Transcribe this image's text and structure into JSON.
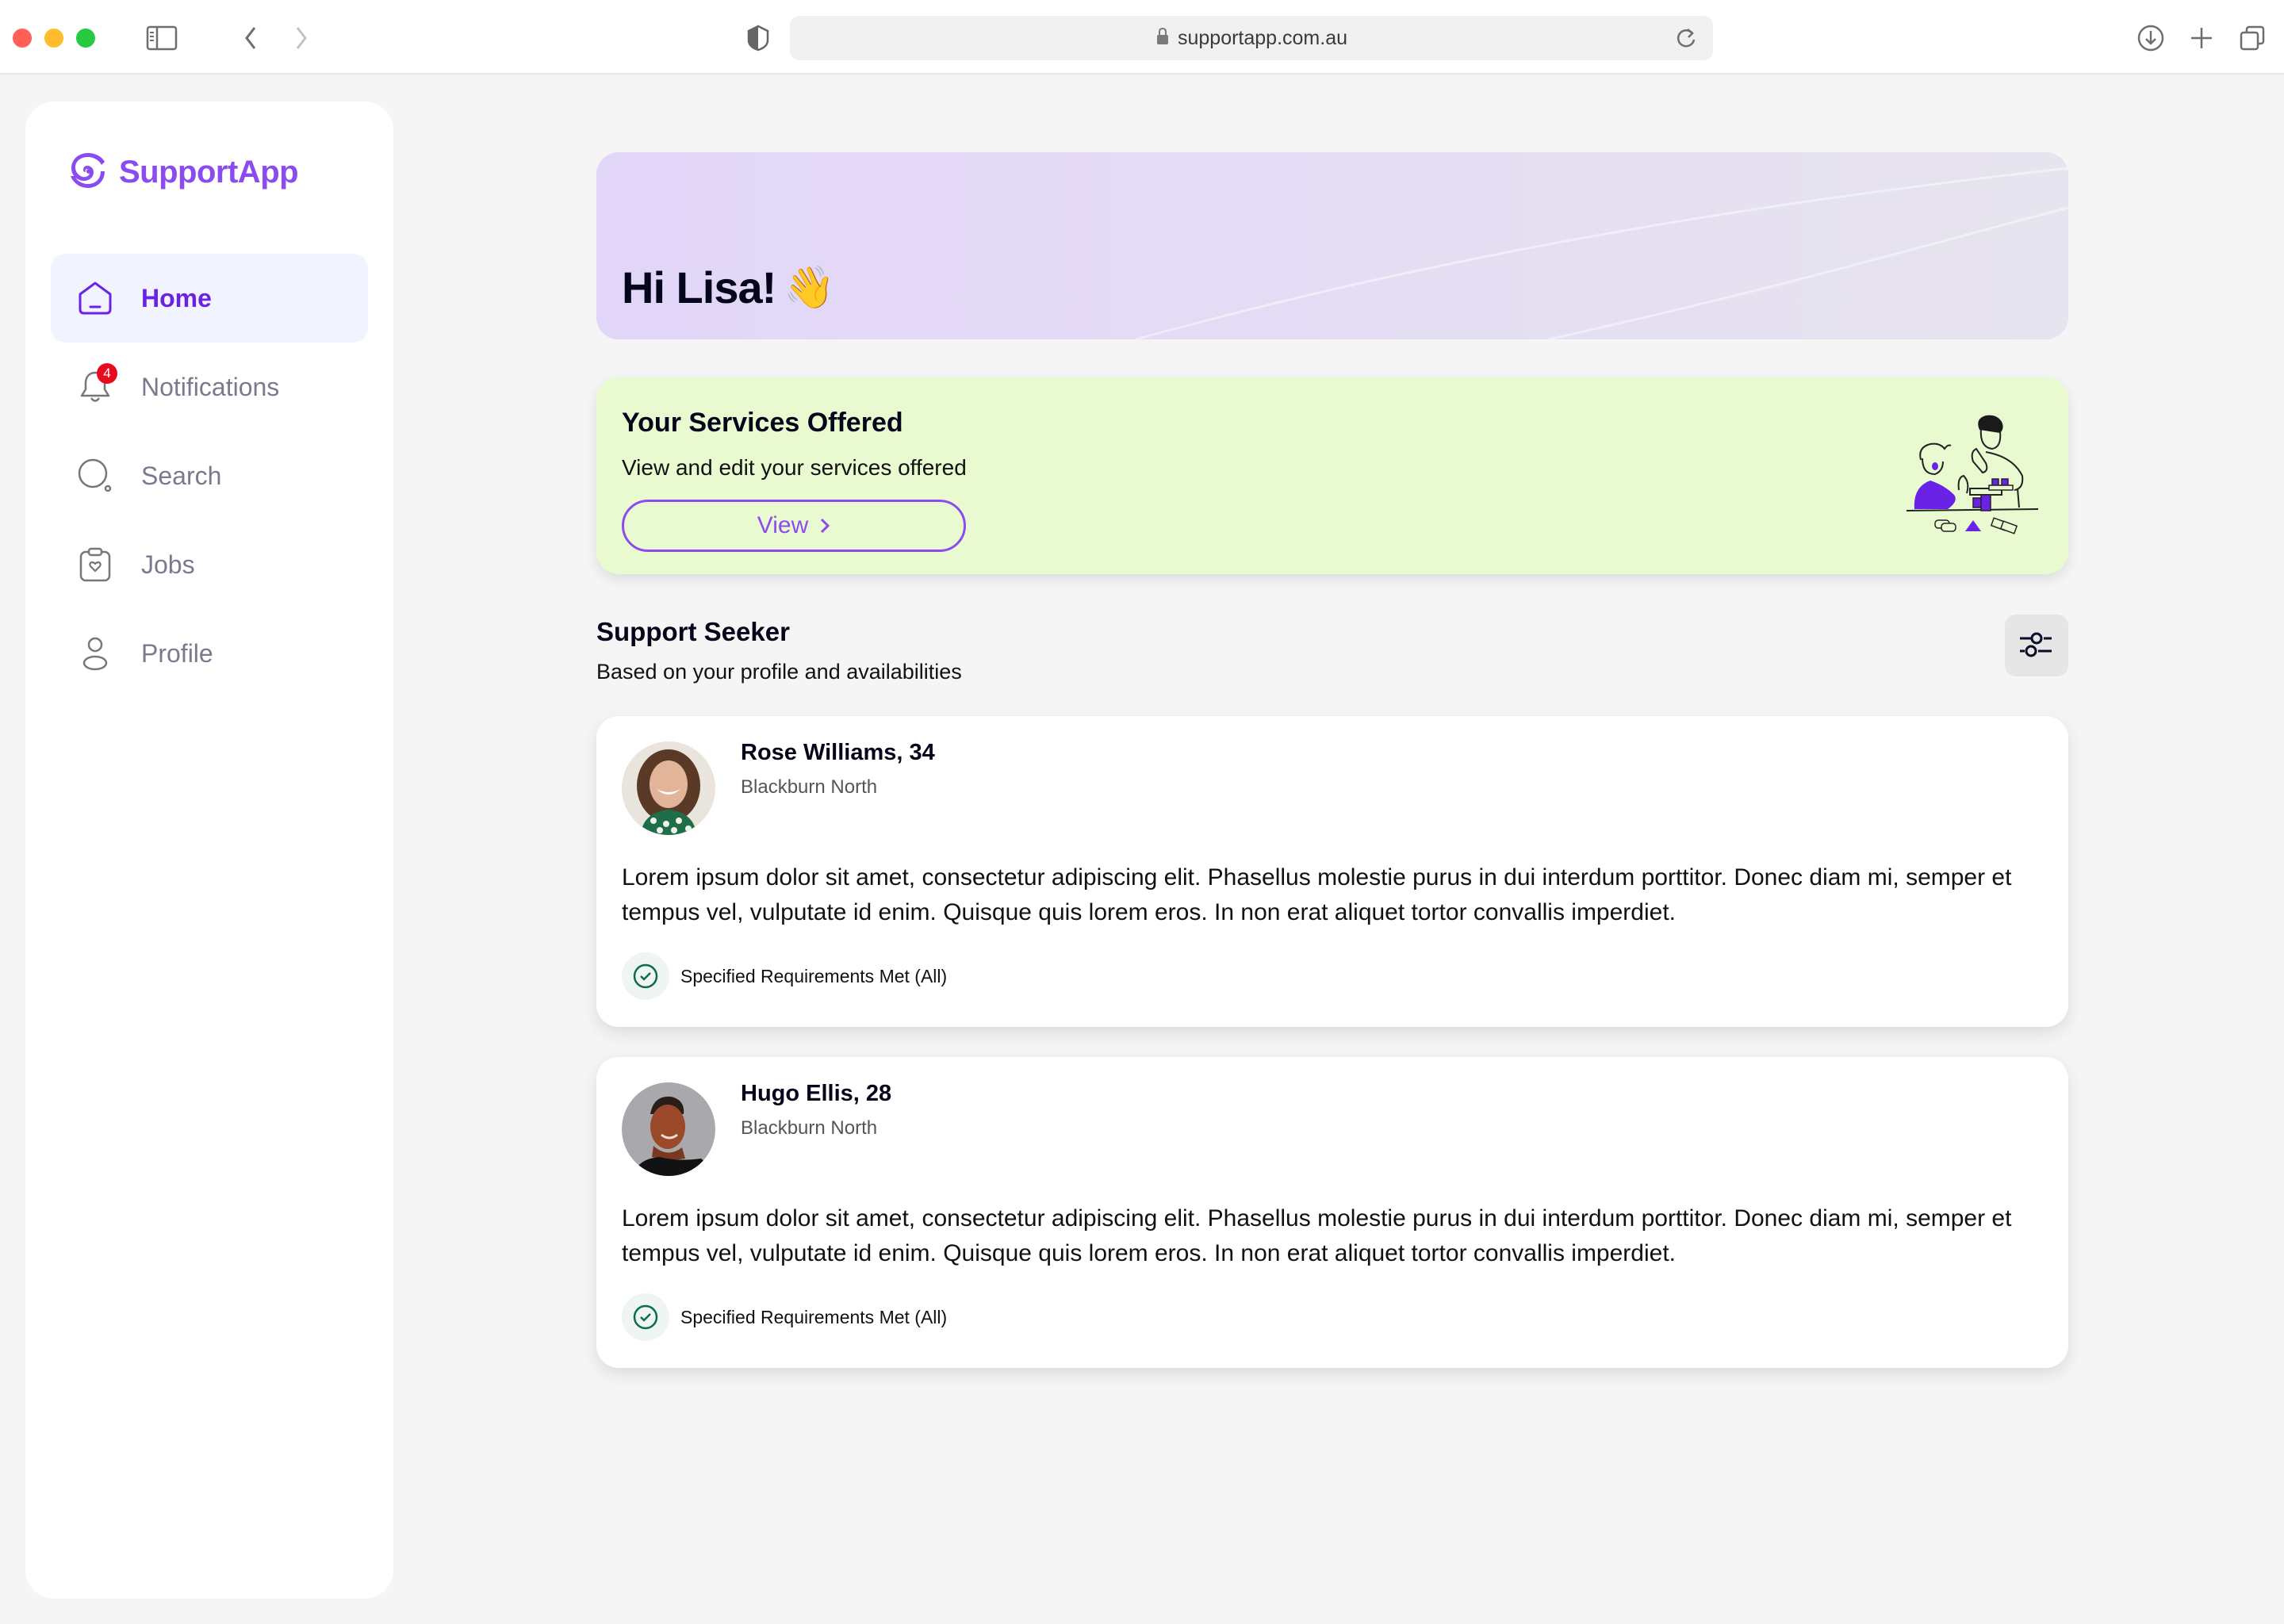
{
  "browser": {
    "url": "supportapp.com.au",
    "icons": {
      "sidebar_toggle": "sidebar-toggle-icon",
      "back": "chevron-left-icon",
      "forward": "chevron-right-icon",
      "privacy": "shield-icon",
      "lock": "lock-icon",
      "reload": "reload-icon",
      "download": "download-icon",
      "new_tab": "plus-icon",
      "tabs": "tab-overview-icon"
    }
  },
  "brand": {
    "name": "SupportApp",
    "color": "#8a4cf0"
  },
  "sidebar": {
    "items": [
      {
        "label": "Home",
        "icon": "home-icon",
        "active": true
      },
      {
        "label": "Notifications",
        "icon": "bell-icon",
        "badge": "4"
      },
      {
        "label": "Search",
        "icon": "search-icon"
      },
      {
        "label": "Jobs",
        "icon": "clipboard-heart-icon"
      },
      {
        "label": "Profile",
        "icon": "user-icon"
      }
    ]
  },
  "banner": {
    "greeting": "Hi Lisa!",
    "emoji": "👋"
  },
  "services": {
    "title": "Your Services Offered",
    "subtitle": "View and edit your services offered",
    "button_label": "View",
    "illustration": "people-playing-blocks-illustration"
  },
  "support_seeker": {
    "title": "Support Seeker",
    "subtitle": "Based on your profile and availabilities",
    "filter_icon": "sliders-icon",
    "cards": [
      {
        "name": "Rose Williams, 34",
        "location": "Blackburn North",
        "description": "Lorem ipsum dolor sit amet, consectetur adipiscing elit. Phasellus molestie purus in dui interdum porttitor. Donec diam mi, semper et tempus vel, vulputate id enim. Quisque quis lorem eros. In non erat aliquet tortor convallis imperdiet.",
        "requirement": "Specified Requirements Met (All)"
      },
      {
        "name": "Hugo Ellis, 28",
        "location": "Blackburn North",
        "description": "Lorem ipsum dolor sit amet, consectetur adipiscing elit. Phasellus molestie purus in dui interdum porttitor. Donec diam mi, semper et tempus vel, vulputate id enim. Quisque quis lorem eros. In non erat aliquet tortor convallis imperdiet.",
        "requirement": "Specified Requirements Met (All)"
      }
    ]
  },
  "colors": {
    "accent": "#8a4cf0",
    "active_nav": "#6a22e6",
    "badge": "#e80a1e",
    "services_bg": "#eafad0",
    "success": "#0e6b4e"
  }
}
